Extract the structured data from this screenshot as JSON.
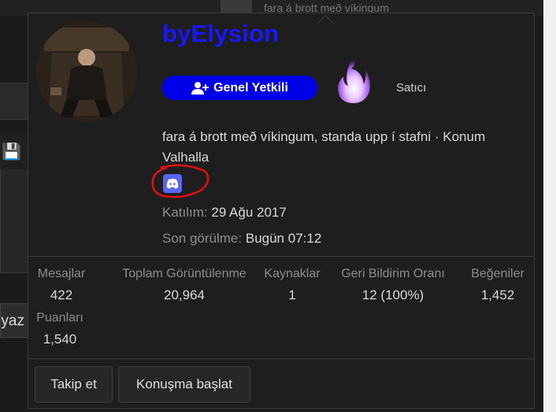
{
  "background": {
    "top_text": "fara á brott með víkingum",
    "left_button_text": "yaz"
  },
  "profile": {
    "username": "byElysion",
    "username_color": "#1717ff",
    "role": "Genel Yetkili",
    "role_icon": "user-plus-icon",
    "secondary_title": "Satıcı",
    "bio": "fara á brott með víkingum, standa upp í stafni · Konum Valhalla",
    "social_icon": "discord-icon",
    "joined_label": "Katılım:",
    "joined_value": "29 Ağu 2017",
    "last_seen_label": "Son görülme:",
    "last_seen_value": "Bugün 07:12"
  },
  "stats": [
    {
      "label": "Mesajlar",
      "value": "422"
    },
    {
      "label": "Toplam Görüntülenme",
      "value": "20,964"
    },
    {
      "label": "Kaynaklar",
      "value": "1"
    },
    {
      "label": "Geri Bildirim Oranı",
      "value": "12 (100%)"
    },
    {
      "label": "Beğeniler",
      "value": "1,452"
    },
    {
      "label": "Puanları",
      "value": "1,540"
    }
  ],
  "actions": {
    "follow": "Takip et",
    "start_conversation": "Konuşma başlat"
  },
  "colors": {
    "badge": "#0000e8",
    "discord": "#5865f2",
    "annotation": "#e01010"
  }
}
